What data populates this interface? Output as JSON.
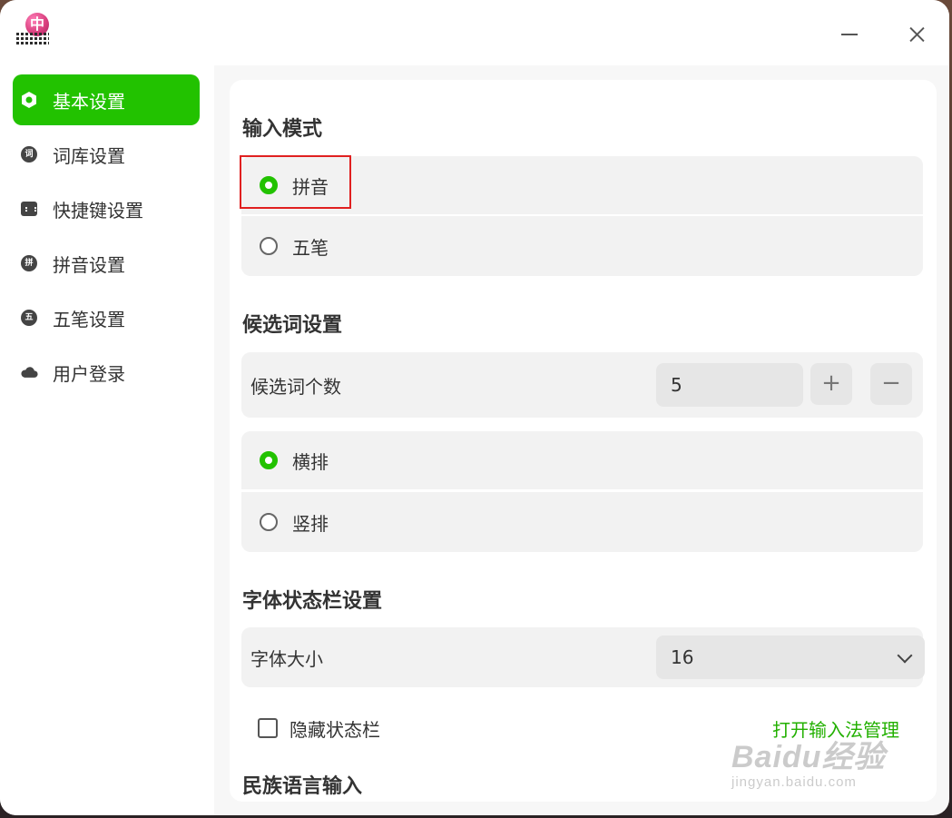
{
  "titlebar": {
    "logo_char": "中",
    "minimize_label": "minimize",
    "close_label": "close"
  },
  "sidebar": {
    "items": [
      {
        "label": "基本设置",
        "icon": "hexagon-icon",
        "icon_char": ""
      },
      {
        "label": "词库设置",
        "icon": "dict-icon",
        "icon_char": "词"
      },
      {
        "label": "快捷键设置",
        "icon": "keyboard-icon",
        "icon_char": ""
      },
      {
        "label": "拼音设置",
        "icon": "pinyin-icon",
        "icon_char": "拼"
      },
      {
        "label": "五笔设置",
        "icon": "wubi-icon",
        "icon_char": "五"
      },
      {
        "label": "用户登录",
        "icon": "cloud-icon",
        "icon_char": ""
      }
    ]
  },
  "main": {
    "input_mode": {
      "title": "输入模式",
      "options": [
        "拼音",
        "五笔"
      ],
      "selected": 0
    },
    "candidate": {
      "title": "候选词设置",
      "count_label": "候选词个数",
      "count_value": "5",
      "plus": "+",
      "minus": "−",
      "layout_options": [
        "横排",
        "竖排"
      ],
      "selected": 0
    },
    "font_status": {
      "title": "字体状态栏设置",
      "size_label": "字体大小",
      "size_value": "16",
      "hide_status_label": "隐藏状态栏",
      "open_manager_link": "打开输入法管理"
    },
    "next_section_title": "民族语言输入"
  },
  "watermark": {
    "main": "Baidu经验",
    "sub": "jingyan.baidu.com"
  },
  "colors": {
    "accent": "#22c200",
    "highlight": "#e02020"
  }
}
